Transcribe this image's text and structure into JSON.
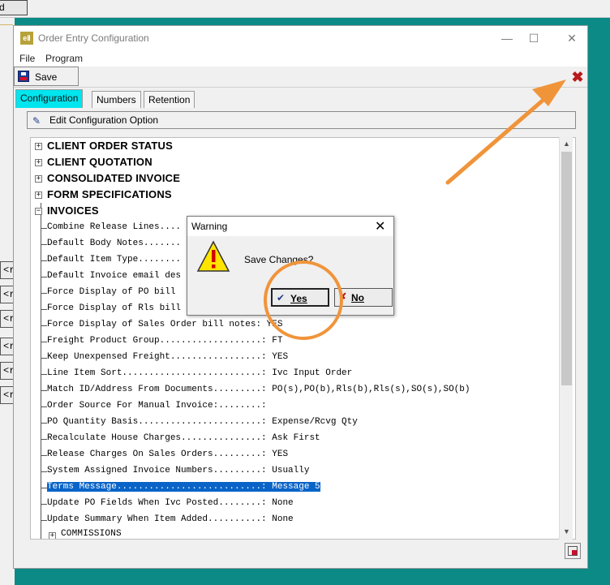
{
  "background": {
    "top_button_label": "d",
    "side_buttons": [
      "<r",
      "<r",
      "<r",
      "<r",
      "<r",
      "<r"
    ]
  },
  "window": {
    "icon_text": "eⅡ",
    "title": "Order Entry Configuration",
    "minimize": "—",
    "maximize": "☐",
    "close": "✕"
  },
  "menu": {
    "file": "File",
    "program": "Program"
  },
  "toolbar": {
    "save_label": "Save",
    "close_icon": "✖"
  },
  "tabs": [
    {
      "label": "Configuration",
      "active": true
    },
    {
      "label": "Numbers",
      "active": false
    },
    {
      "label": "Retention",
      "active": false
    }
  ],
  "edit_option": {
    "label": "Edit Configuration Option"
  },
  "tree": {
    "groups": [
      {
        "label": "CLIENT ORDER STATUS",
        "expanded": false
      },
      {
        "label": "CLIENT QUOTATION",
        "expanded": false
      },
      {
        "label": "CONSOLIDATED INVOICE",
        "expanded": false
      },
      {
        "label": "FORM SPECIFICATIONS",
        "expanded": false
      },
      {
        "label": "INVOICES",
        "expanded": true
      }
    ],
    "invoice_items": [
      "Combine Release Lines....",
      "Default Body Notes.......",
      "Default Item Type........",
      "Default Invoice email des",
      "Force Display of PO bill",
      "Force Display of Rls bill",
      "Force Display of Sales Order bill notes: YES",
      "Freight Product Group...................: FT",
      "Keep Unexpensed Freight.................: YES",
      "Line Item Sort..........................: Ivc Input Order",
      "Match ID/Address From Documents.........: PO(s),PO(b),Rls(b),Rls(s),SO(s),SO(b)",
      "Order Source For Manual Invoice:........:",
      "PO Quantity Basis.......................: Expense/Rcvg Qty",
      "Recalculate House Charges...............: Ask First",
      "Release Charges On Sales Orders.........: YES",
      "System Assigned Invoice Numbers.........: Usually",
      "Terms Message...........................: Message 5",
      "Update PO Fields When Ivc Posted........: None",
      "Update Summary When Item Added..........: None"
    ],
    "selected_index": 16,
    "next_group": "COMMISSIONS"
  },
  "dialog": {
    "title": "Warning",
    "close": "✕",
    "message": "Save Changes?",
    "yes_label": "Yes",
    "no_label": "No"
  },
  "colors": {
    "desktop": "#0b8a86",
    "active_tab": "#00e5ee",
    "selection": "#0a64c8",
    "annotation": "#f0943a",
    "close_icon": "#b8191c"
  }
}
